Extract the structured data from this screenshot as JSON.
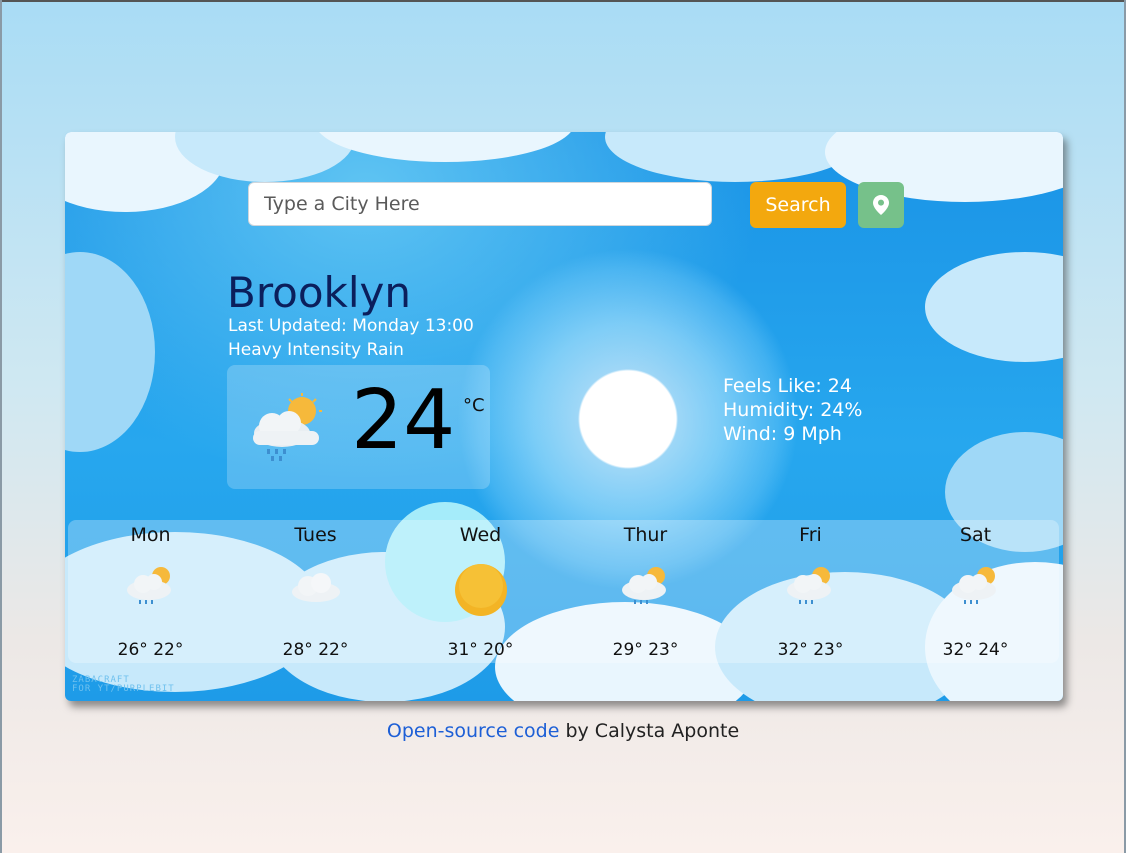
{
  "search": {
    "placeholder": "Type a City Here",
    "value": "",
    "button_label": "Search"
  },
  "location_button": {
    "icon": "map-pin-icon"
  },
  "current": {
    "city": "Brooklyn",
    "last_updated": "Last Updated: Monday 13:00",
    "description": "Heavy Intensity Rain",
    "temperature": "24",
    "unit": "°C",
    "icon": "rain-cloud-sun-icon",
    "feels_like": "Feels Like: 24",
    "humidity": "Humidity: 24%",
    "wind": "Wind: 9 Mph"
  },
  "forecast": [
    {
      "day": "Mon",
      "range": "26° 22°",
      "icon": "rain-cloud-sun-icon"
    },
    {
      "day": "Tues",
      "range": "28° 22°",
      "icon": "cloud-icon"
    },
    {
      "day": "Wed",
      "range": "31° 20°",
      "icon": "sun-icon"
    },
    {
      "day": "Thur",
      "range": "29° 23°",
      "icon": "rain-cloud-sun-icon"
    },
    {
      "day": "Fri",
      "range": "32° 23°",
      "icon": "rain-cloud-sun-icon"
    },
    {
      "day": "Sat",
      "range": "32° 24°",
      "icon": "rain-cloud-sun-icon"
    }
  ],
  "art_credit": [
    "ZABACRAFT",
    "FOR YT/PURPLEBIT"
  ],
  "footer": {
    "link_text": "Open-source code",
    "suffix": " by Calysta Aponte"
  },
  "colors": {
    "search_button": "#f3a80e",
    "location_button": "#76c18a",
    "city_text": "#0b1f5c",
    "footer_link": "#1d5fd6"
  }
}
